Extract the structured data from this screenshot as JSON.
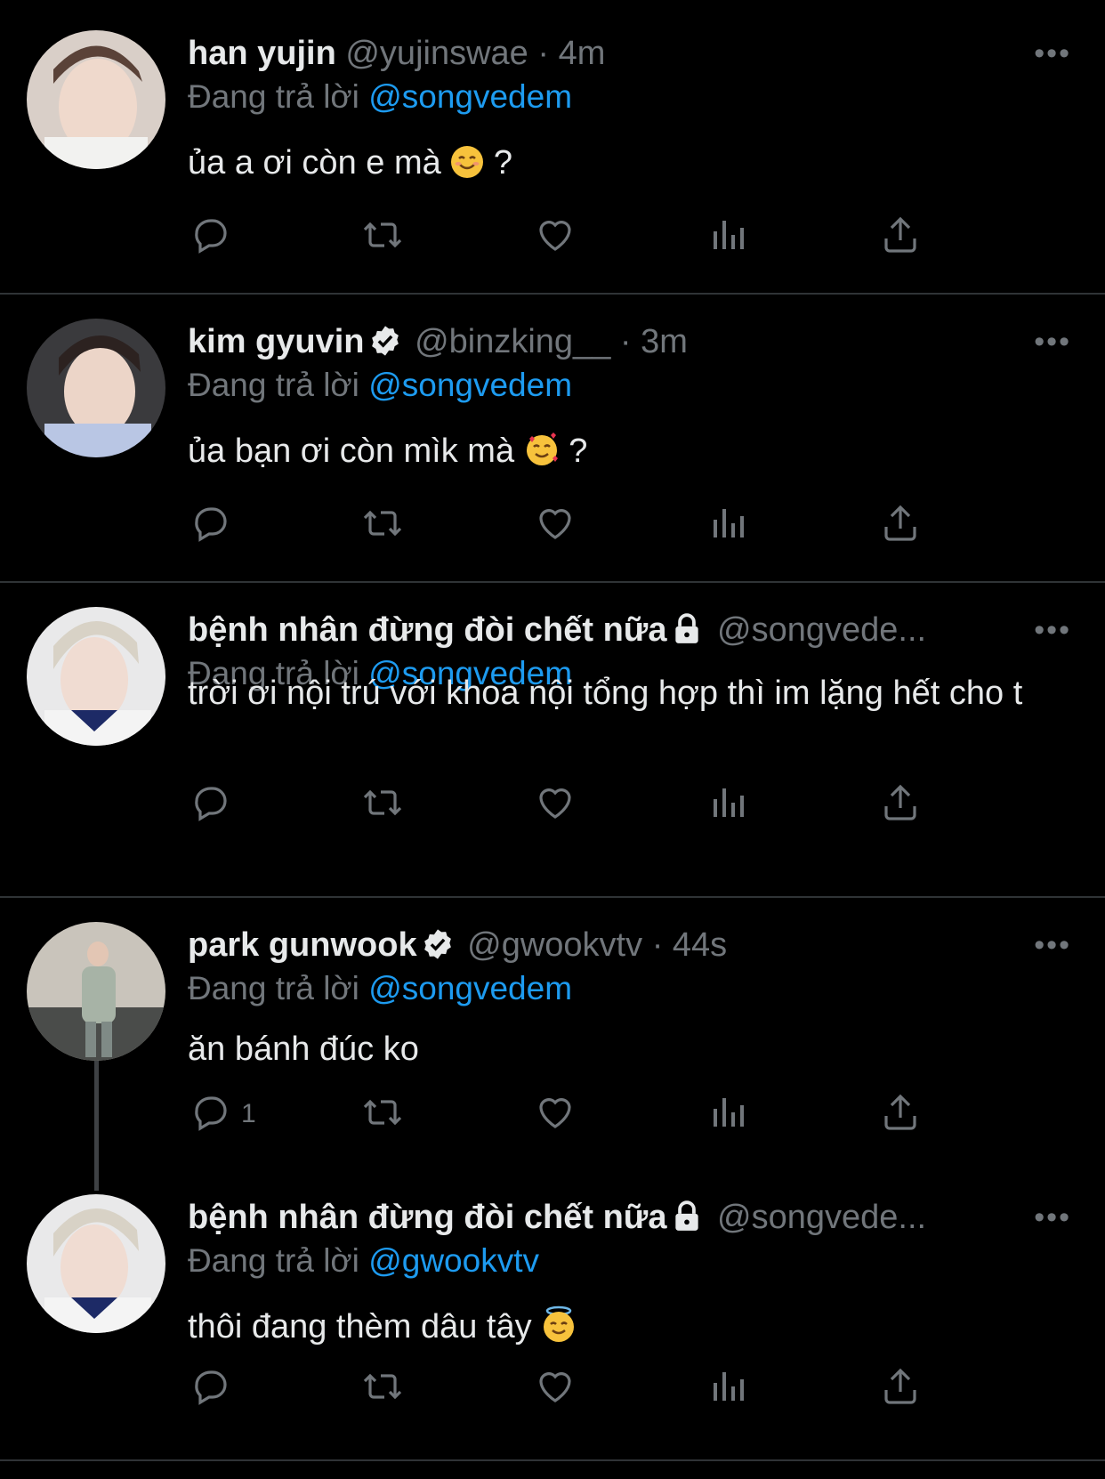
{
  "tweets": [
    {
      "name": "han yujin",
      "handle": "@yujinswae",
      "dot": "·",
      "time": "4m",
      "reply_prefix": "Đang trả lời",
      "reply_to": "@songvedem",
      "text": "ủa a ơi còn e mà",
      "text_suffix": "?",
      "emoji": "smiling-face-emoji",
      "more": "•••"
    },
    {
      "name": "kim gyuvin",
      "handle": "@binzking__",
      "dot": "·",
      "time": "3m",
      "reply_prefix": "Đang trả lời",
      "reply_to": "@songvedem",
      "text": "ủa bạn ơi còn mìk mà",
      "text_suffix": "?",
      "emoji": "smiling-face-with-hearts-emoji",
      "more": "•••"
    },
    {
      "name": "bệnh nhân đừng đòi chết nữa",
      "handle": "@songvede...",
      "reply_prefix": "Đang trả lời",
      "reply_to": "@songvedem",
      "text": "trời ơi nội trú với khoa nội tổng hợp thì im lặng hết cho t",
      "more": "•••"
    },
    {
      "name": "park gunwook",
      "handle": "@gwookvtv",
      "dot": "·",
      "time": "44s",
      "reply_prefix": "Đang trả lời",
      "reply_to": "@songvedem",
      "text": "ăn bánh đúc ko",
      "reply_count": "1",
      "more": "•••"
    },
    {
      "name": "bệnh nhân đừng đòi chết nữa",
      "handle": "@songvede...",
      "reply_prefix": "Đang trả lời",
      "reply_to": "@gwookvtv",
      "text": "thôi đang thèm dâu tây",
      "emoji": "smiling-face-with-halo-emoji",
      "more": "•••"
    }
  ],
  "colors": {
    "background": "#000000",
    "text": "#e7e9ea",
    "secondary": "#71767b",
    "link": "#1d9bf0",
    "divider": "#2f3336"
  }
}
